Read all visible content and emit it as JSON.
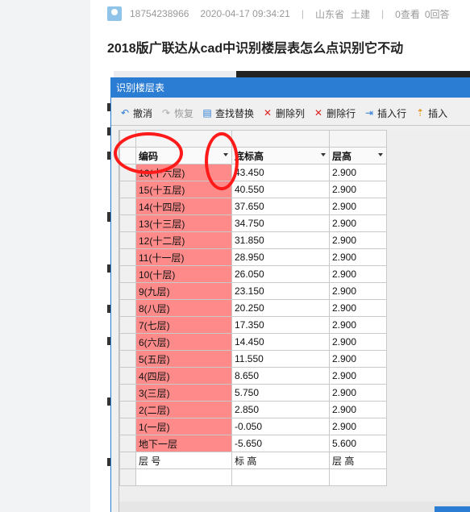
{
  "post": {
    "phone": "18754238966",
    "datetime": "2020-04-17 09:34:21",
    "separator": "|",
    "region": "山东省",
    "category": "土建",
    "views": "0查看",
    "answers": "0回答",
    "title": "2018版广联达从cad中识别楼层表怎么点识别它不动"
  },
  "dialog": {
    "title": "识别楼层表",
    "toolbar": [
      {
        "label": "撤消",
        "icon": "undo-icon",
        "disabled": false
      },
      {
        "label": "恢复",
        "icon": "redo-icon",
        "disabled": true
      },
      {
        "label": "查找替换",
        "icon": "find-replace-icon",
        "disabled": false
      },
      {
        "label": "删除列",
        "icon": "delete-column-icon",
        "disabled": false
      },
      {
        "label": "删除行",
        "icon": "delete-row-icon",
        "disabled": false
      },
      {
        "label": "插入行",
        "icon": "insert-row-icon",
        "disabled": false
      },
      {
        "label": "插入",
        "icon": "insert-column-icon",
        "disabled": false
      }
    ],
    "columns": [
      "编码",
      "底标高",
      "层高"
    ],
    "rows": [
      [
        "16(十六层)",
        "43.450",
        "2.900"
      ],
      [
        "15(十五层)",
        "40.550",
        "2.900"
      ],
      [
        "14(十四层)",
        "37.650",
        "2.900"
      ],
      [
        "13(十三层)",
        "34.750",
        "2.900"
      ],
      [
        "12(十二层)",
        "31.850",
        "2.900"
      ],
      [
        "11(十一层)",
        "28.950",
        "2.900"
      ],
      [
        "10(十层)",
        "26.050",
        "2.900"
      ],
      [
        "9(九层)",
        "23.150",
        "2.900"
      ],
      [
        "8(八层)",
        "20.250",
        "2.900"
      ],
      [
        "7(七层)",
        "17.350",
        "2.900"
      ],
      [
        "6(六层)",
        "14.450",
        "2.900"
      ],
      [
        "5(五层)",
        "11.550",
        "2.900"
      ],
      [
        "4(四层)",
        "8.650",
        "2.900"
      ],
      [
        "3(三层)",
        "5.750",
        "2.900"
      ],
      [
        "2(二层)",
        "2.850",
        "2.900"
      ],
      [
        "1(一层)",
        "-0.050",
        "2.900"
      ],
      [
        "地下一层",
        "-5.650",
        "5.600"
      ]
    ],
    "footer_row": [
      "层 号",
      "标 高",
      "层 高"
    ]
  },
  "colors": {
    "highlight": "#ff8a8a",
    "annotation": "#ff1a1a",
    "accent": "#2b7cd3"
  }
}
